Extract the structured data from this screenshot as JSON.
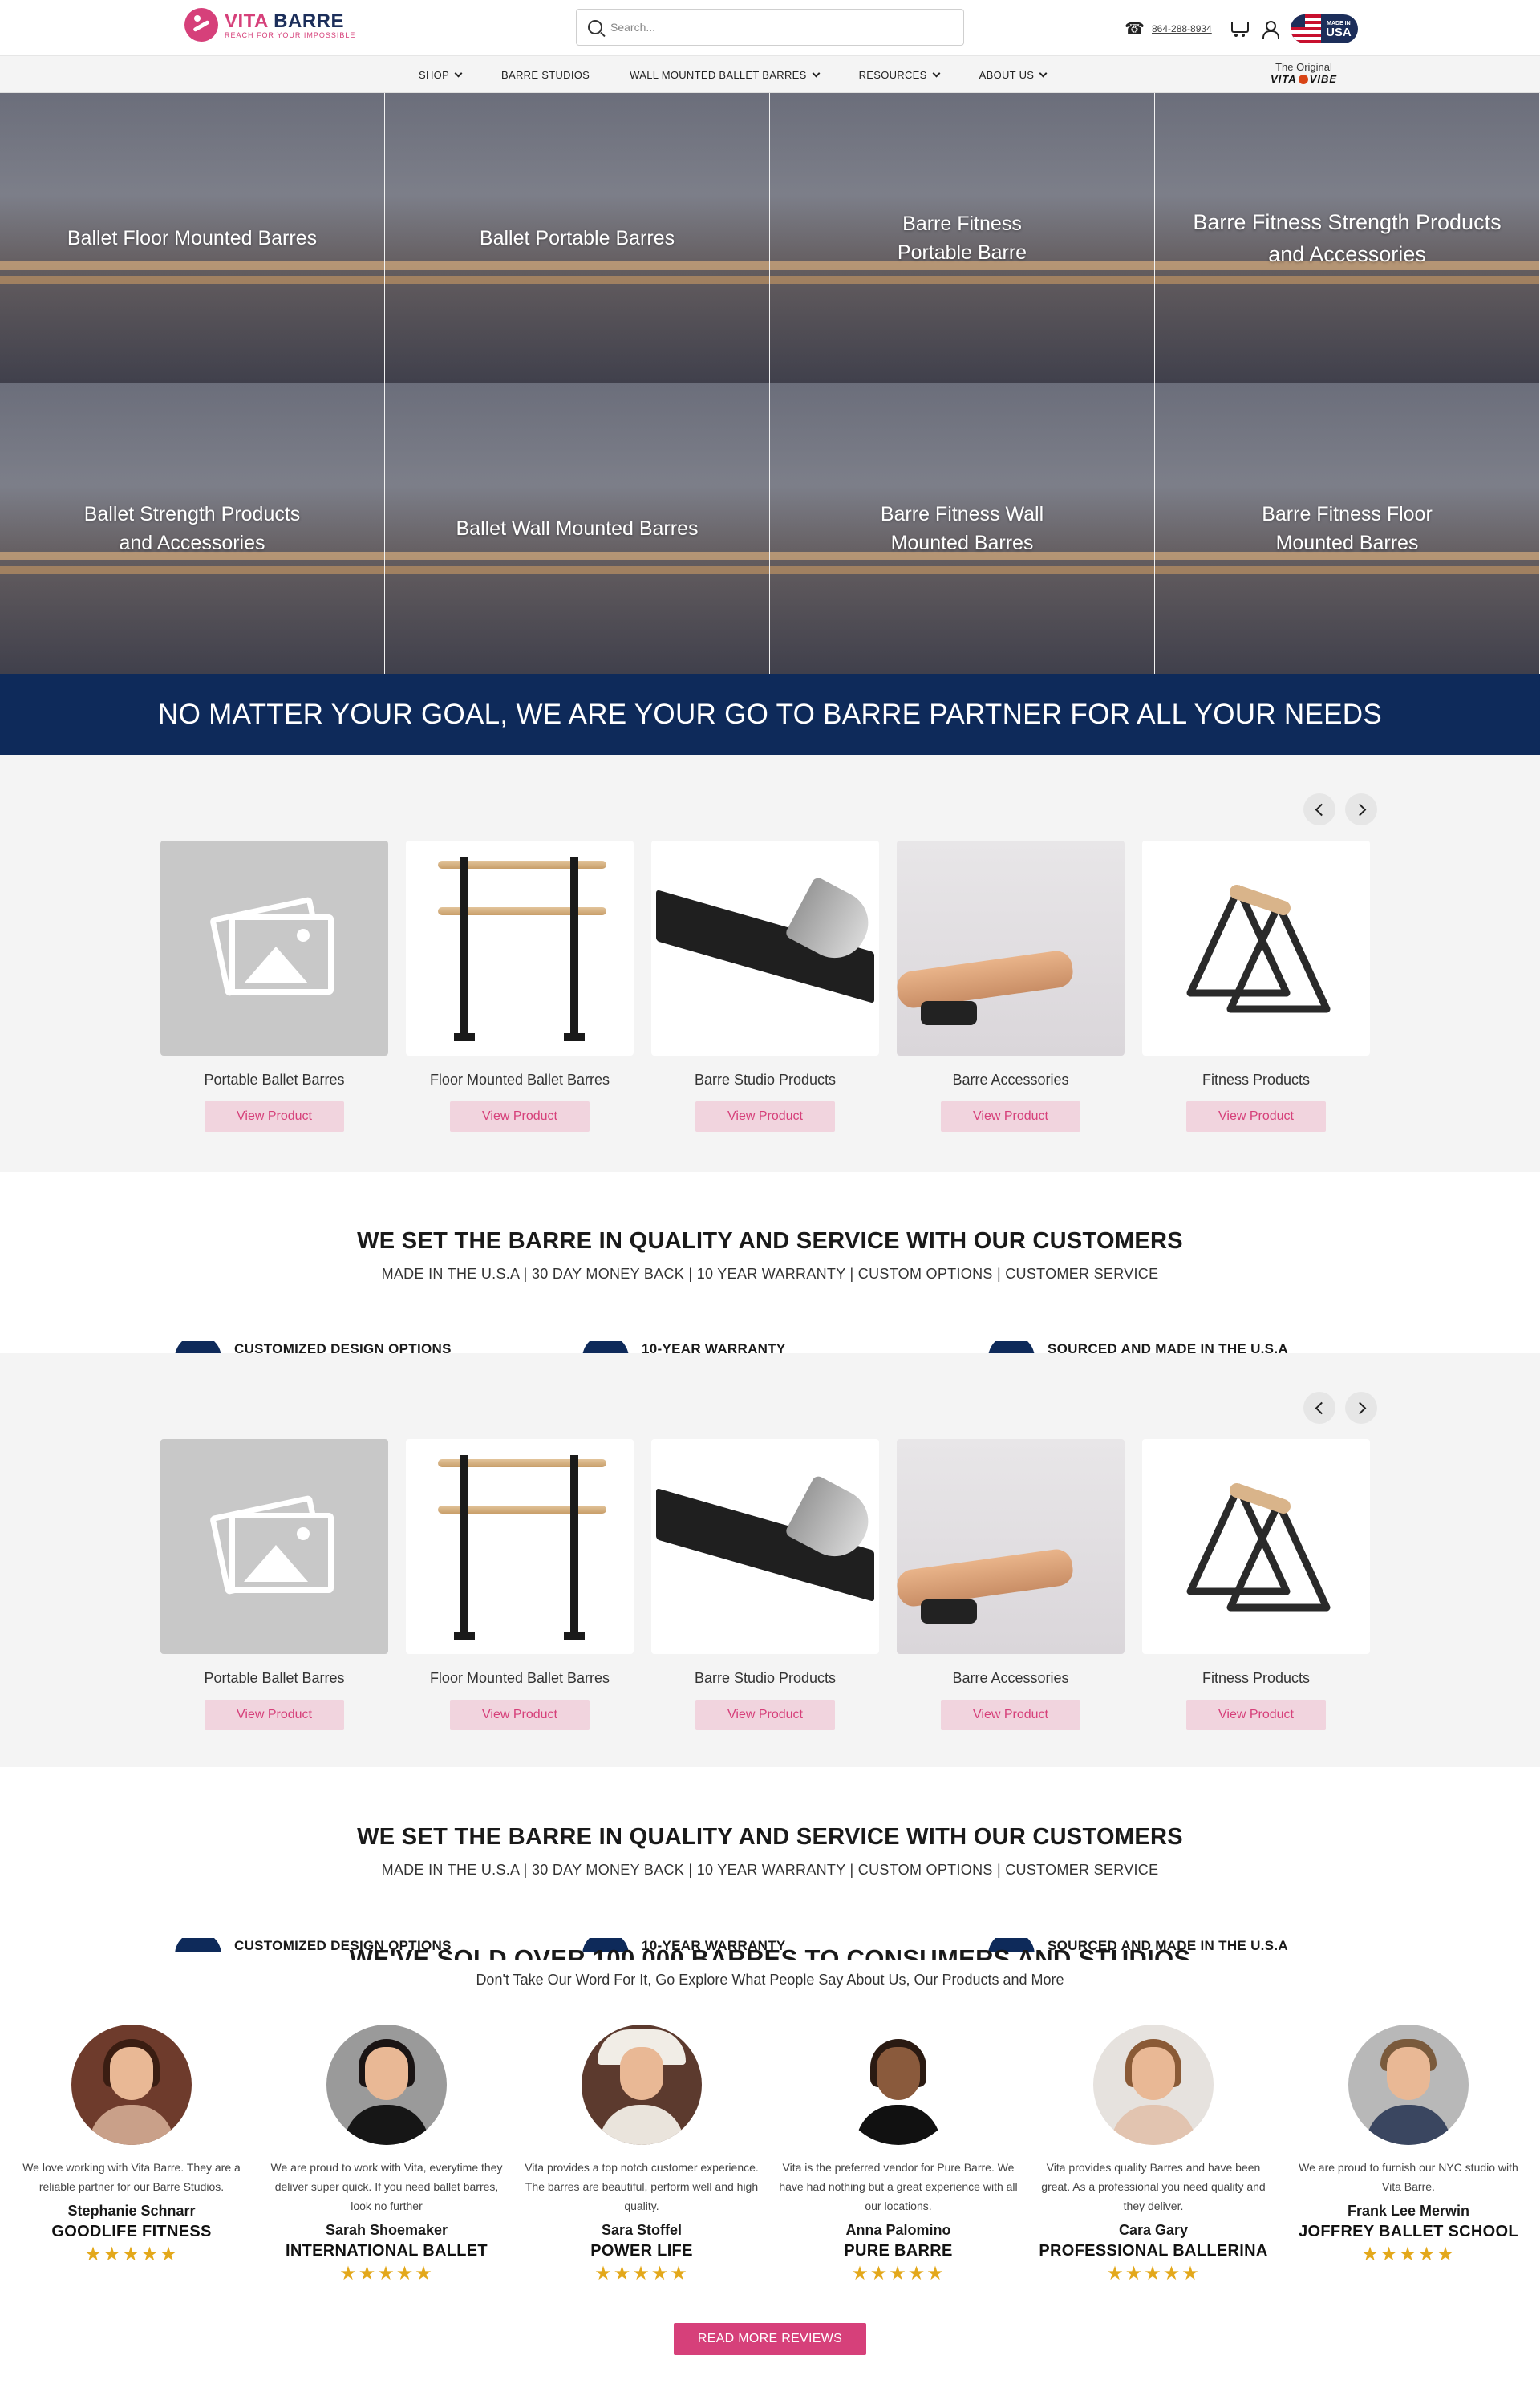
{
  "header": {
    "logo": {
      "brand_a": "VITA",
      "brand_b": "BARRE",
      "tagline": "REACH FOR YOUR IMPOSSIBLE"
    },
    "search_placeholder": "Search...",
    "phone": "864-288-8934",
    "usa_badge": {
      "small": "MADE IN",
      "big": "USA"
    }
  },
  "nav": {
    "items": [
      {
        "label": "SHOP",
        "dropdown": true
      },
      {
        "label": "BARRE STUDIOS",
        "dropdown": false
      },
      {
        "label": "WALL MOUNTED BALLET BARRES",
        "dropdown": true
      },
      {
        "label": "RESOURCES",
        "dropdown": true
      },
      {
        "label": "ABOUT US",
        "dropdown": true
      }
    ],
    "original": {
      "top": "The Original",
      "brand_a": "VITA",
      "brand_b": "VIBE"
    }
  },
  "categories": [
    "Ballet Floor Mounted Barres",
    "Ballet Portable Barres",
    "Barre Fitness Portable Barre",
    "Barre Fitness Strength Products and Accessories",
    "Ballet Strength Products and Accessories",
    "Ballet Wall Mounted Barres",
    "Barre Fitness Wall Mounted Barres",
    "Barre Fitness Floor Mounted Barres"
  ],
  "banner": "NO MATTER YOUR GOAL, WE ARE YOUR GO TO BARRE PARTNER FOR ALL YOUR NEEDS",
  "products": [
    {
      "name": "Portable Ballet Barres",
      "button": "View Product"
    },
    {
      "name": "Floor Mounted Ballet Barres",
      "button": "View Product"
    },
    {
      "name": "Barre Studio Products",
      "button": "View Product"
    },
    {
      "name": "Barre Accessories",
      "button": "View Product"
    },
    {
      "name": "Fitness Products",
      "button": "View Product"
    }
  ],
  "quality": {
    "title": "WE SET THE BARRE IN QUALITY AND SERVICE WITH OUR CUSTOMERS",
    "subtitle": "MADE IN THE U.S.A | 30 DAY MONEY BACK | 10 YEAR WARRANTY | CUSTOM OPTIONS | CUSTOMER SERVICE",
    "features": [
      "CUSTOMIZED DESIGN OPTIONS",
      "10-YEAR WARRANTY",
      "SOURCED AND MADE IN THE U.S.A"
    ]
  },
  "reviews_section": {
    "title": "WE'VE SOLD OVER 100,000 BARRES TO CONSUMERS AND STUDIOS",
    "subtitle": "Don't Take Our Word For It, Go Explore What People Say About Us, Our Products and More",
    "read_more": "READ MORE REVIEWS",
    "items": [
      {
        "quote": "We love working with Vita Barre. They are a reliable partner for our Barre Studios.",
        "name": "Stephanie Schnarr",
        "org": "GOODLIFE FITNESS",
        "stars": "★★★★★"
      },
      {
        "quote": "We are proud to work with Vita, everytime they deliver super quick. If you need ballet barres, look no further",
        "name": "Sarah Shoemaker",
        "org": "INTERNATIONAL BALLET",
        "stars": "★★★★★"
      },
      {
        "quote": "Vita provides a top notch customer experience. The barres are beautiful, perform well and high quality.",
        "name": "Sara Stoffel",
        "org": "POWER LIFE",
        "stars": "★★★★★"
      },
      {
        "quote": "Vita is the preferred vendor for Pure Barre. We have had nothing but a great experience with all our locations.",
        "name": "Anna Palomino",
        "org": "PURE BARRE",
        "stars": "★★★★★"
      },
      {
        "quote": "Vita provides quality Barres and have been great. As a professional you need quality and they deliver.",
        "name": "Cara Gary",
        "org": "PROFESSIONAL BALLERINA",
        "stars": "★★★★★"
      },
      {
        "quote": "We are proud to furnish our NYC studio with Vita Barre.",
        "name": "Frank Lee Merwin",
        "org": "JOFFREY BALLET SCHOOL",
        "stars": "★★★★★"
      }
    ]
  },
  "colors": {
    "navy": "#0e2a5a",
    "pink": "#d6407a",
    "star": "#e3a81b",
    "panel": "#f4f4f4"
  }
}
